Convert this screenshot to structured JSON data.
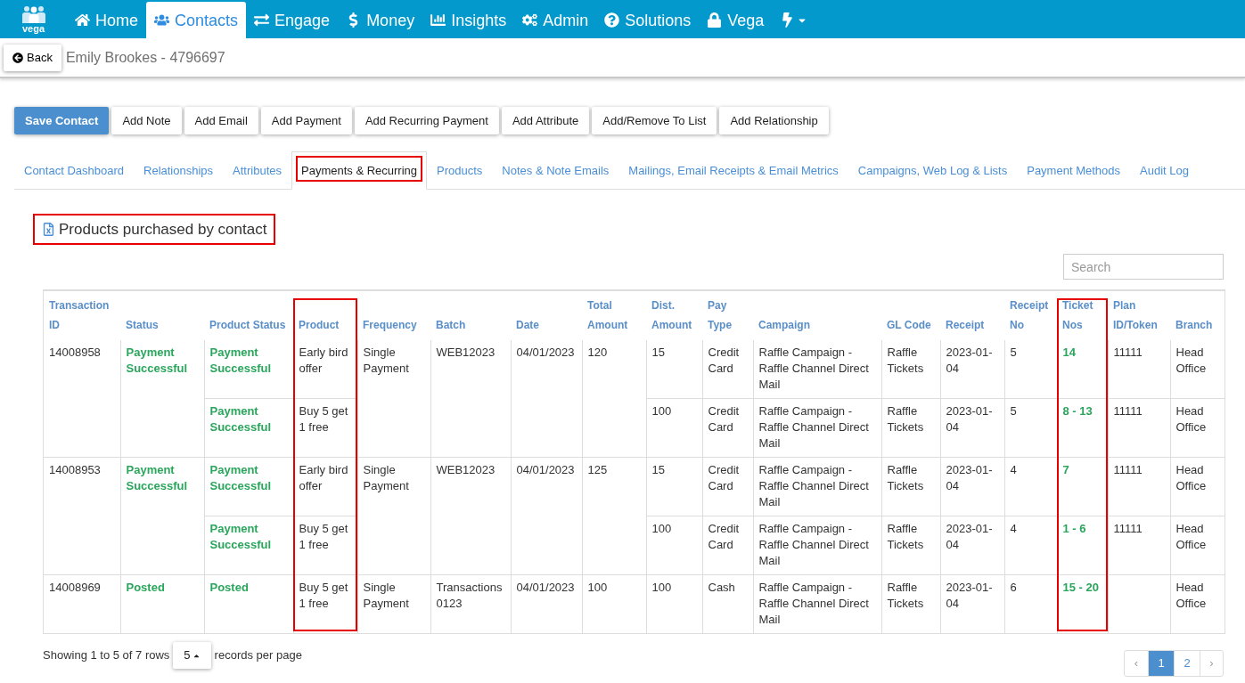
{
  "nav": {
    "logo_text": "vega",
    "items": [
      {
        "label": "Home",
        "selected": false
      },
      {
        "label": "Contacts",
        "selected": true
      },
      {
        "label": "Engage",
        "selected": false
      },
      {
        "label": "Money",
        "selected": false
      },
      {
        "label": "Insights",
        "selected": false
      },
      {
        "label": "Admin",
        "selected": false
      },
      {
        "label": "Solutions",
        "selected": false
      },
      {
        "label": "Vega",
        "selected": false
      }
    ]
  },
  "page_header": {
    "back_button": "Back",
    "title": "Emily Brookes - 4796697"
  },
  "action_buttons": [
    {
      "label": "Save Contact",
      "kind": "primary"
    },
    {
      "label": "Add Note",
      "kind": "default"
    },
    {
      "label": "Add Email",
      "kind": "default"
    },
    {
      "label": "Add Payment",
      "kind": "default"
    },
    {
      "label": "Add Recurring Payment",
      "kind": "default"
    },
    {
      "label": "Add Attribute",
      "kind": "default"
    },
    {
      "label": "Add/Remove To List",
      "kind": "default"
    },
    {
      "label": "Add Relationship",
      "kind": "default"
    }
  ],
  "tabs": [
    {
      "label": "Contact Dashboard",
      "selected": false,
      "highlighted": false
    },
    {
      "label": "Relationships",
      "selected": false,
      "highlighted": false
    },
    {
      "label": "Attributes",
      "selected": false,
      "highlighted": false
    },
    {
      "label": "Payments & Recurring",
      "selected": true,
      "highlighted": true
    },
    {
      "label": "Products",
      "selected": false,
      "highlighted": false
    },
    {
      "label": "Notes & Note Emails",
      "selected": false,
      "highlighted": false
    },
    {
      "label": "Mailings, Email Receipts & Email Metrics",
      "selected": false,
      "highlighted": false
    },
    {
      "label": "Campaigns, Web Log & Lists",
      "selected": false,
      "highlighted": false
    },
    {
      "label": "Payment Methods",
      "selected": false,
      "highlighted": false
    },
    {
      "label": "Audit Log",
      "selected": false,
      "highlighted": false
    }
  ],
  "section": {
    "title": "Products purchased by contact",
    "highlighted": true
  },
  "search": {
    "placeholder": "Search"
  },
  "table": {
    "columns": [
      {
        "label": "Transaction ID",
        "highlighted": false
      },
      {
        "label": "Status",
        "highlighted": false
      },
      {
        "label": "Product Status",
        "highlighted": false
      },
      {
        "label": "Product",
        "highlighted": true
      },
      {
        "label": "Frequency",
        "highlighted": false
      },
      {
        "label": "Batch",
        "highlighted": false
      },
      {
        "label": "Date",
        "highlighted": false
      },
      {
        "label": "Total Amount",
        "highlighted": false
      },
      {
        "label": "Dist. Amount",
        "highlighted": false
      },
      {
        "label": "Pay Type",
        "highlighted": false
      },
      {
        "label": "Campaign",
        "highlighted": false
      },
      {
        "label": "GL Code",
        "highlighted": false
      },
      {
        "label": "Receipt",
        "highlighted": false
      },
      {
        "label": "Receipt No",
        "highlighted": false
      },
      {
        "label": "Ticket Nos",
        "highlighted": true
      },
      {
        "label": "Plan ID/Token",
        "highlighted": false
      },
      {
        "label": "Branch",
        "highlighted": false
      }
    ],
    "rows": [
      {
        "transaction_id": "14008958",
        "status": "Payment Successful",
        "frequency": "Single Payment",
        "batch": "WEB12023",
        "date": "04/01/2023",
        "total_amount": "120",
        "products": [
          {
            "product_status": "Payment Successful",
            "product": "Early bird offer",
            "dist_amount": "15",
            "pay_type": "Credit Card",
            "campaign": "Raffle Campaign - Raffle Channel Direct Mail",
            "gl_code": "Raffle Tickets",
            "receipt": "2023-01-04",
            "receipt_no": "5",
            "ticket_nos": "14",
            "plan_id_token": "11111",
            "branch": "Head Office"
          },
          {
            "product_status": "Payment Successful",
            "product": "Buy 5 get 1 free",
            "dist_amount": "100",
            "pay_type": "Credit Card",
            "campaign": "Raffle Campaign - Raffle Channel Direct Mail",
            "gl_code": "Raffle Tickets",
            "receipt": "2023-01-04",
            "receipt_no": "5",
            "ticket_nos": "8 - 13",
            "plan_id_token": "11111",
            "branch": "Head Office"
          }
        ]
      },
      {
        "transaction_id": "14008953",
        "status": "Payment Successful",
        "frequency": "Single Payment",
        "batch": "WEB12023",
        "date": "04/01/2023",
        "total_amount": "125",
        "products": [
          {
            "product_status": "Payment Successful",
            "product": "Early bird offer",
            "dist_amount": "15",
            "pay_type": "Credit Card",
            "campaign": "Raffle Campaign - Raffle Channel Direct Mail",
            "gl_code": "Raffle Tickets",
            "receipt": "2023-01-04",
            "receipt_no": "4",
            "ticket_nos": "7",
            "plan_id_token": "11111",
            "branch": "Head Office"
          },
          {
            "product_status": "Payment Successful",
            "product": "Buy 5 get 1 free",
            "dist_amount": "100",
            "pay_type": "Credit Card",
            "campaign": "Raffle Campaign - Raffle Channel Direct Mail",
            "gl_code": "Raffle Tickets",
            "receipt": "2023-01-04",
            "receipt_no": "4",
            "ticket_nos": "1 - 6",
            "plan_id_token": "11111",
            "branch": "Head Office"
          }
        ]
      },
      {
        "transaction_id": "14008969",
        "status": "Posted",
        "frequency": "Single Payment",
        "batch": "Transactions 0123",
        "date": "04/01/2023",
        "total_amount": "100",
        "products": [
          {
            "product_status": "Posted",
            "product": "Buy 5 get 1 free",
            "dist_amount": "100",
            "pay_type": "Cash",
            "campaign": "Raffle Campaign - Raffle Channel Direct Mail",
            "gl_code": "Raffle Tickets",
            "receipt": "2023-01-04",
            "receipt_no": "6",
            "ticket_nos": "15 - 20",
            "branch": "Head Office"
          }
        ]
      }
    ]
  },
  "footer": {
    "summary": "Showing 1 to 5 of 7 rows",
    "page_size": "5",
    "page_size_label": "records per page"
  },
  "pagination": {
    "prev": "‹",
    "pages": [
      {
        "label": "1",
        "selected": true
      },
      {
        "label": "2",
        "selected": false
      }
    ],
    "next": "›"
  }
}
